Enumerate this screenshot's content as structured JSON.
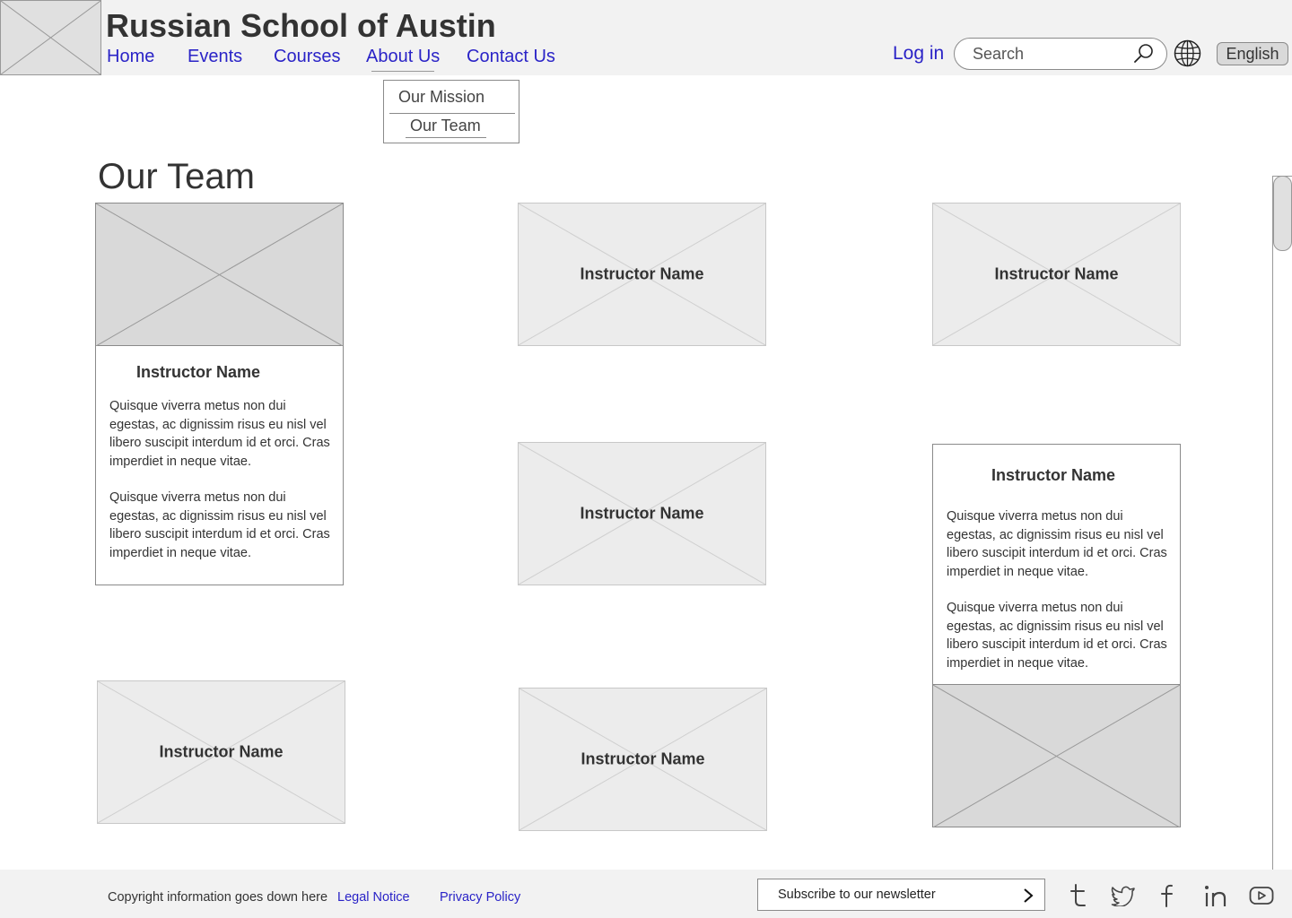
{
  "header": {
    "site_title": "Russian School of Austin",
    "nav": [
      {
        "label": "Home"
      },
      {
        "label": "Events"
      },
      {
        "label": "Courses"
      },
      {
        "label": "About Us"
      },
      {
        "label": "Contact Us"
      }
    ],
    "login_label": "Log in",
    "search_placeholder": "Search",
    "language_label": "English"
  },
  "dropdown": {
    "items": [
      {
        "label": "Our Mission"
      },
      {
        "label": "Our Team"
      }
    ]
  },
  "page": {
    "title": "Our Team"
  },
  "team": {
    "cards": [
      {
        "name": "Instructor Name",
        "expanded": true,
        "bio": [
          "Quisque viverra metus non dui egestas, ac dignissim risus eu nisl vel libero suscipit interdum id et orci. Cras imperdiet in neque vitae.",
          "Quisque viverra metus non dui egestas, ac dignissim risus eu nisl vel libero suscipit interdum id et orci. Cras imperdiet in neque vitae."
        ]
      },
      {
        "name": "Instructor Name"
      },
      {
        "name": "Instructor Name"
      },
      {
        "name": "Instructor Name"
      },
      {
        "name": "Instructor Name",
        "expanded": true,
        "bio": [
          "Quisque viverra metus non dui egestas, ac dignissim risus eu nisl vel libero suscipit interdum id et orci. Cras imperdiet in neque vitae.",
          "Quisque viverra metus non dui egestas, ac dignissim risus eu nisl vel libero suscipit interdum id et orci. Cras imperdiet in neque vitae."
        ]
      },
      {
        "name": "Instructor Name"
      },
      {
        "name": "Instructor Name"
      }
    ]
  },
  "footer": {
    "copyright": "Copyright information goes down here",
    "links": [
      {
        "label": "Legal Notice"
      },
      {
        "label": "Privacy Policy"
      }
    ],
    "newsletter_label": "Subscribe to our newsletter",
    "social_icons": [
      "tumblr-icon",
      "twitter-icon",
      "facebook-icon",
      "linkedin-icon",
      "youtube-icon"
    ]
  },
  "colors": {
    "link": "#2a23c7",
    "header_bg": "#f2f2f2",
    "text": "#333333"
  }
}
